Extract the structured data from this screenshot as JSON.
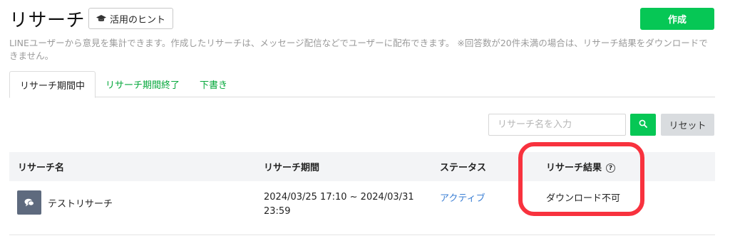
{
  "header": {
    "title": "リサーチ",
    "hint_label": "活用のヒント",
    "create_label": "作成"
  },
  "description": "LINEユーザーから意見を集計できます。作成したリサーチは、メッセージ配信などでユーザーに配布できます。 ※回答数が20件未満の場合は、リサーチ結果をダウンロードできません。",
  "tabs": [
    {
      "label": "リサーチ期間中"
    },
    {
      "label": "リサーチ期間終了"
    },
    {
      "label": "下書き"
    }
  ],
  "search": {
    "placeholder": "リサーチ名を入力",
    "reset_label": "リセット"
  },
  "table": {
    "columns": [
      "リサーチ名",
      "リサーチ期間",
      "ステータス",
      "リサーチ結果"
    ],
    "rows": [
      {
        "name": "テストリサーチ",
        "period_line1": "2024/03/25 17:10 ~ 2024/03/31",
        "period_line2": "23:59",
        "status": "アクティブ",
        "result": "ダウンロード不可"
      }
    ]
  },
  "colors": {
    "accent": "#06c755",
    "status_link": "#3b7fd4",
    "highlight": "#f8323e"
  },
  "icons": {
    "hint": "graduation-cap-icon",
    "search": "search-icon",
    "help": "question-circle-icon",
    "research": "speech-bubble-icon"
  }
}
